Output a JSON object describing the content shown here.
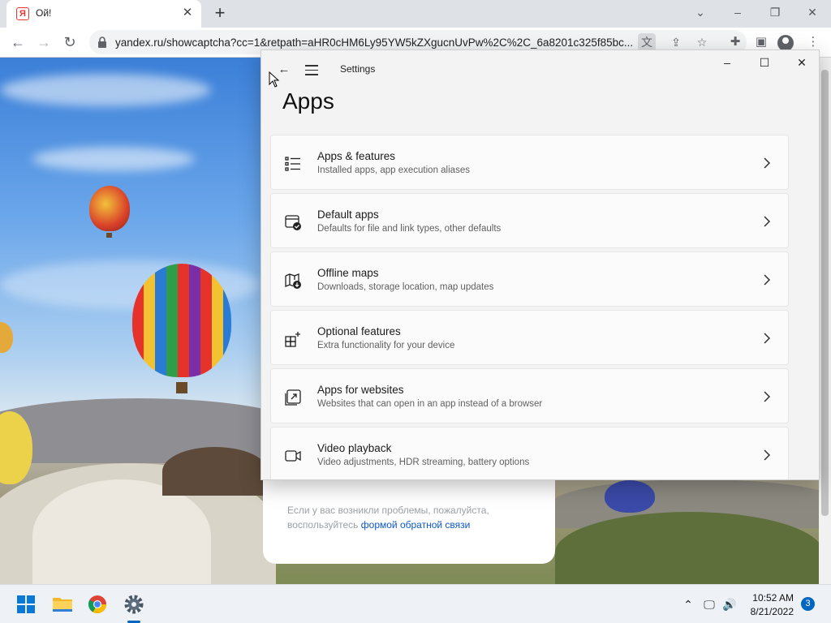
{
  "browser": {
    "tab_title": "Ой!",
    "favicon_letter": "Я",
    "url": "yandex.ru/showcaptcha?cc=1&retpath=aHR0cHM6Ly95YW5kZXgucnUvPw%2C%2C_6a8201c325f85bc...",
    "icons": [
      "back-arrow-icon",
      "forward-arrow-icon",
      "reload-icon",
      "lock-icon",
      "translate-icon",
      "share-icon",
      "star-icon",
      "extensions-icon",
      "side-panel-icon",
      "profile-icon",
      "kebab-menu-icon"
    ]
  },
  "captcha_page": {
    "message": "Если у вас возникли проблемы, пожалуйста, воспользуйтесь",
    "link_text": "формой обратной связи"
  },
  "settings": {
    "app_title": "Settings",
    "heading": "Apps",
    "items": [
      {
        "title": "Apps & features",
        "subtitle": "Installed apps, app execution aliases",
        "icon": "apps-list-icon"
      },
      {
        "title": "Default apps",
        "subtitle": "Defaults for file and link types, other defaults",
        "icon": "default-apps-icon"
      },
      {
        "title": "Offline maps",
        "subtitle": "Downloads, storage location, map updates",
        "icon": "map-icon"
      },
      {
        "title": "Optional features",
        "subtitle": "Extra functionality for your device",
        "icon": "optional-features-icon"
      },
      {
        "title": "Apps for websites",
        "subtitle": "Websites that can open in an app instead of a browser",
        "icon": "open-in-app-icon"
      },
      {
        "title": "Video playback",
        "subtitle": "Video adjustments, HDR streaming, battery options",
        "icon": "video-camera-icon"
      }
    ]
  },
  "taskbar": {
    "time": "10:52 AM",
    "date": "8/21/2022",
    "notification_count": "3",
    "apps": [
      "windows-start-icon",
      "file-explorer-icon",
      "chrome-icon",
      "settings-gear-icon"
    ]
  },
  "colors": {
    "accent": "#0067c0",
    "link": "#0b57d0",
    "settings_bg": "#f3f3f3"
  }
}
